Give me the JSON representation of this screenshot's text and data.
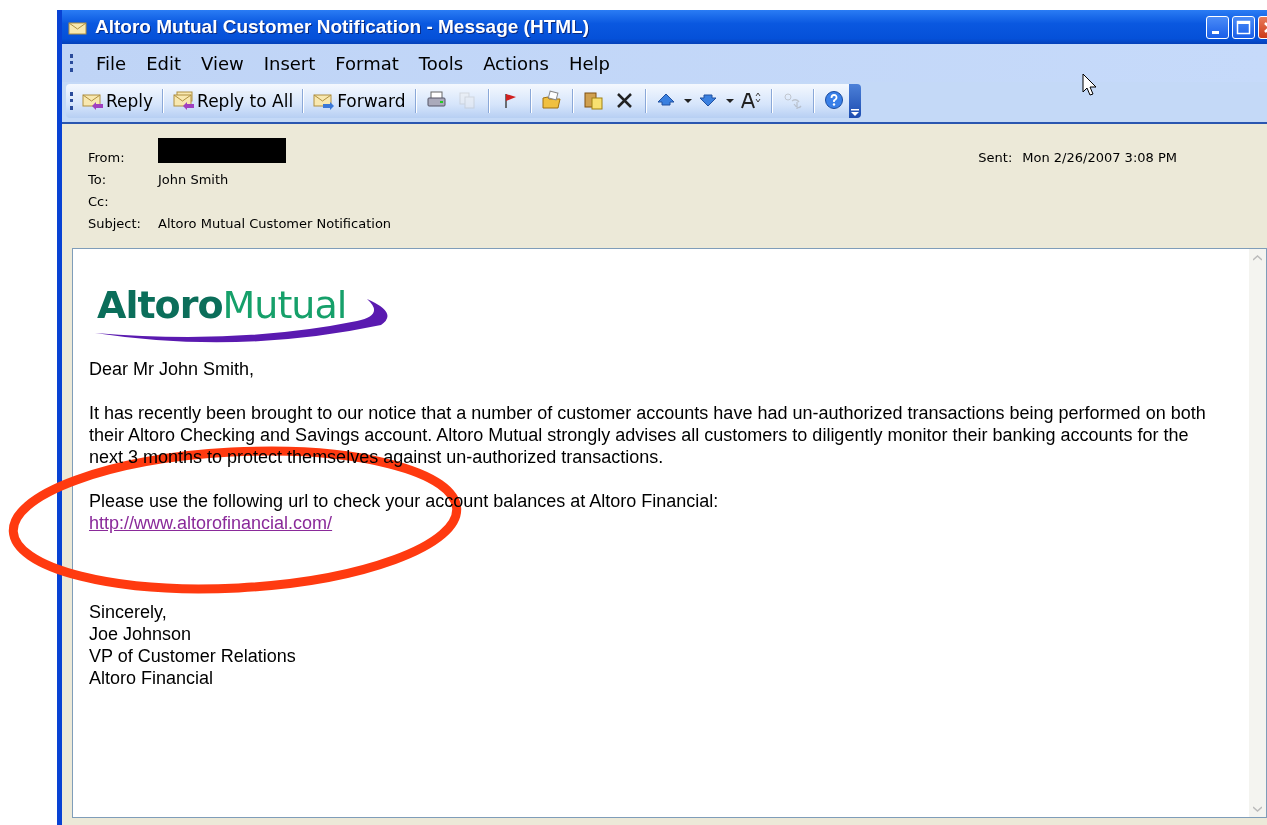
{
  "window": {
    "title": "Altoro Mutual Customer Notification - Message (HTML)"
  },
  "menu": [
    "File",
    "Edit",
    "View",
    "Insert",
    "Format",
    "Tools",
    "Actions",
    "Help"
  ],
  "toolbar": [
    {
      "kind": "reply",
      "label": "Reply",
      "disabled": false,
      "dropdown": false,
      "separator_after": true
    },
    {
      "kind": "reply-all",
      "label": "Reply to All",
      "disabled": false,
      "dropdown": false,
      "separator_after": true
    },
    {
      "kind": "forward",
      "label": "Forward",
      "disabled": false,
      "dropdown": false,
      "separator_after": true
    },
    {
      "kind": "print",
      "disabled": false,
      "dropdown": false,
      "separator_after": false
    },
    {
      "kind": "copy",
      "disabled": true,
      "dropdown": false,
      "separator_after": true
    },
    {
      "kind": "flag",
      "disabled": false,
      "dropdown": false,
      "separator_after": true
    },
    {
      "kind": "move",
      "disabled": false,
      "dropdown": false,
      "separator_after": true
    },
    {
      "kind": "paste",
      "disabled": false,
      "dropdown": false,
      "separator_after": false
    },
    {
      "kind": "delete",
      "disabled": false,
      "dropdown": false,
      "separator_after": true
    },
    {
      "kind": "previous",
      "disabled": false,
      "dropdown": true,
      "separator_after": false
    },
    {
      "kind": "next",
      "disabled": false,
      "dropdown": true,
      "separator_after": false
    },
    {
      "kind": "font-size",
      "disabled": false,
      "dropdown": false,
      "separator_after": true
    },
    {
      "kind": "translate",
      "disabled": true,
      "dropdown": false,
      "separator_after": true
    },
    {
      "kind": "help",
      "disabled": false,
      "dropdown": false,
      "separator_after": false
    }
  ],
  "header": {
    "fields": [
      {
        "label": "From:",
        "redacted": true
      },
      {
        "label": "To:",
        "value": "John Smith",
        "redacted": false
      },
      {
        "label": "Cc:",
        "redacted": false
      },
      {
        "label": "Subject:",
        "value": "Altoro Mutual Customer Notification",
        "redacted": false
      }
    ],
    "sent": {
      "label": "Sent:",
      "value": "Mon 2/26/2007 3:08 PM"
    }
  },
  "body": {
    "logo": "**Altoro**Mutual",
    "greeting": "Dear Mr John Smith,",
    "paragraph": "It has recently been brought to our notice that a number of customer accounts have had un-authorized transactions being performed on both their Altoro Checking and Savings account. Altoro Mutual strongly advises all customers to diligently monitor their banking accounts for the next 3 months to protect themselves against un-authorized transactions.",
    "link_intro": "Please use the following url to check your account balances at Altoro Financial:",
    "link": "http://www.altorofinancial.com/",
    "signature": [
      "Sincerely,",
      "Joe Johnson",
      "VP of Customer Relations",
      "Altoro Financial"
    ]
  }
}
